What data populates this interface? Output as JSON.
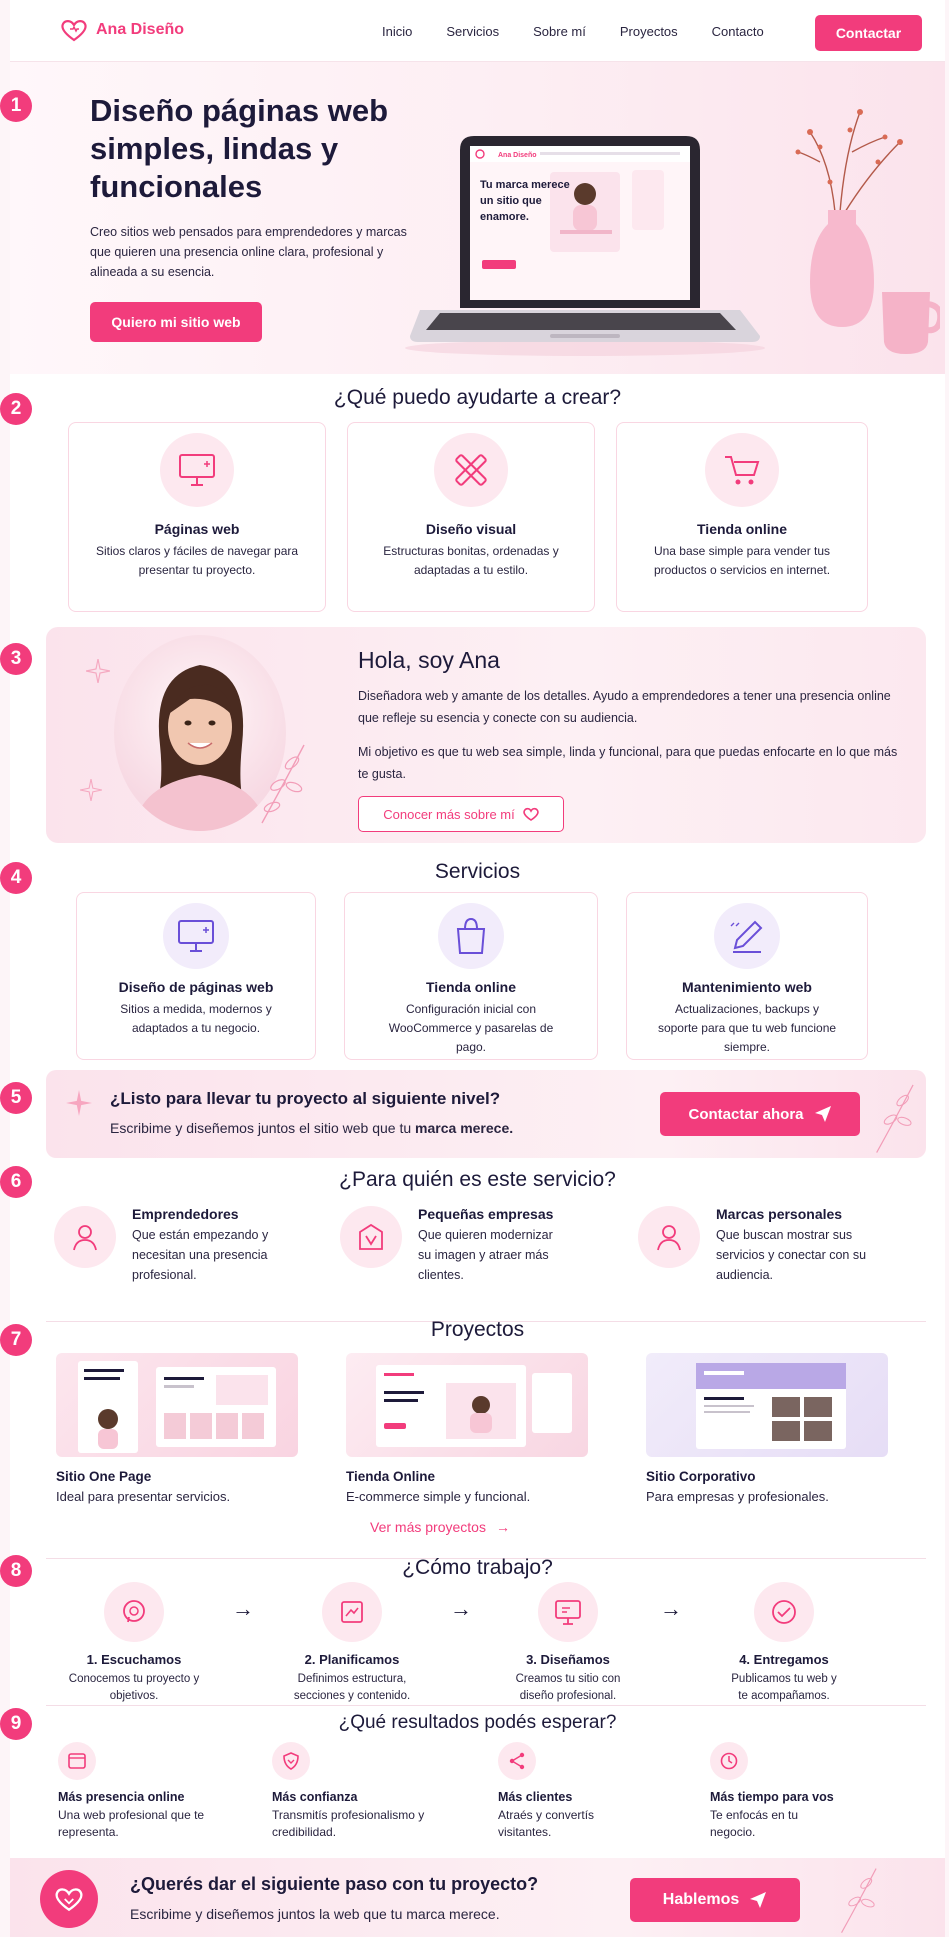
{
  "brand": {
    "name": "Ana Diseño",
    "accent": "#f23c7c",
    "soft": "#fde8ef"
  },
  "nav": {
    "items": [
      "Inicio",
      "Servicios",
      "Sobre mí",
      "Proyectos",
      "Contacto"
    ],
    "cta": "Contactar"
  },
  "badges": [
    "1",
    "2",
    "3",
    "4",
    "5",
    "6",
    "7",
    "8",
    "9"
  ],
  "hero": {
    "title": "Diseño páginas web simples, lindas y funcionales",
    "text": "Creo sitios web pensados para emprendedores y marcas que quieren una presencia online clara, profesional y alineada a su esencia.",
    "button": "Quiero mi sitio web",
    "mock_brand": "Ana Diseño",
    "mock_headline": "Tu marca merece un sitio que enamore."
  },
  "help": {
    "title": "¿Qué puedo ayudarte a crear?",
    "cards": [
      {
        "icon": "monitor-icon",
        "title": "Páginas web",
        "text": "Sitios claros y fáciles de navegar para presentar tu proyecto."
      },
      {
        "icon": "ruler-pencil-icon",
        "title": "Diseño visual",
        "text": "Estructuras bonitas, ordenadas y adaptadas a tu estilo."
      },
      {
        "icon": "cart-icon",
        "title": "Tienda online",
        "text": "Una base simple para vender tus productos o servicios en internet."
      }
    ]
  },
  "about": {
    "title": "Hola, soy Ana",
    "p1": "Diseñadora web y amante de los detalles. Ayudo a emprendedores a tener una presencia online que refleje su esencia y conecte con su audiencia.",
    "p2": "Mi objetivo es que tu web sea simple, linda y funcional, para que puedas enfocarte en lo que más te gusta.",
    "button": "Conocer más sobre mí"
  },
  "services": {
    "title": "Servicios",
    "cards": [
      {
        "icon": "monitor-icon",
        "title": "Diseño de páginas web",
        "text": "Sitios a medida, modernos y adaptados a tu negocio."
      },
      {
        "icon": "shopping-bag-icon",
        "title": "Tienda online",
        "text": "Configuración inicial con WooCommerce y pasarelas de pago."
      },
      {
        "icon": "pencil-icon",
        "title": "Mantenimiento web",
        "text": "Actualizaciones, backups y soporte para que tu web funcione siempre."
      }
    ]
  },
  "cta": {
    "title": "¿Listo para llevar tu proyecto al siguiente nivel?",
    "text_start": "Escribime y diseñemos juntos el sitio web que tu ",
    "text_bold": "marca merece.",
    "button": "Contactar ahora"
  },
  "audience": {
    "title": "¿Para quién es este servicio?",
    "items": [
      {
        "icon": "person-icon",
        "title": "Emprendedores",
        "text": "Que están empezando y necesitan una presencia profesional."
      },
      {
        "icon": "shop-icon",
        "title": "Pequeñas empresas",
        "text": "Que quieren modernizar su imagen y atraer más clientes."
      },
      {
        "icon": "user-icon",
        "title": "Marcas personales",
        "text": "Que buscan mostrar sus servicios y conectar con su audiencia."
      }
    ]
  },
  "projects": {
    "title": "Proyectos",
    "items": [
      {
        "title": "Sitio One Page",
        "text": "Ideal para presentar servicios."
      },
      {
        "title": "Tienda Online",
        "text": "E-commerce simple y funcional."
      },
      {
        "title": "Sitio Corporativo",
        "text": "Para empresas y profesionales."
      }
    ],
    "more": "Ver más proyectos"
  },
  "process": {
    "title": "¿Cómo trabajo?",
    "steps": [
      {
        "icon": "chat-icon",
        "title": "1. Escuchamos",
        "text": "Conocemos tu proyecto y objetivos."
      },
      {
        "icon": "plan-icon",
        "title": "2. Planificamos",
        "text": "Definimos estructura, secciones y contenido."
      },
      {
        "icon": "design-icon",
        "title": "3. Diseñamos",
        "text": "Creamos tu sitio con diseño profesional."
      },
      {
        "icon": "check-icon",
        "title": "4. Entregamos",
        "text": "Publicamos tu web y te acompañamos."
      }
    ]
  },
  "results": {
    "title": "¿Qué resultados podés esperar?",
    "items": [
      {
        "icon": "window-icon",
        "title": "Más presencia online",
        "text": "Una web profesional que te representa."
      },
      {
        "icon": "shield-heart-icon",
        "title": "Más confianza",
        "text": "Transmitís profesionalismo y credibilidad."
      },
      {
        "icon": "share-icon",
        "title": "Más clientes",
        "text": "Atraés y convertís visitantes."
      },
      {
        "icon": "clock-icon",
        "title": "Más tiempo para vos",
        "text": "Te enfocás en tu negocio."
      }
    ]
  },
  "footer_cta": {
    "title": "¿Querés dar el siguiente paso con tu proyecto?",
    "text": "Escribime y diseñemos juntos la web que tu marca merece.",
    "button": "Hablemos"
  }
}
